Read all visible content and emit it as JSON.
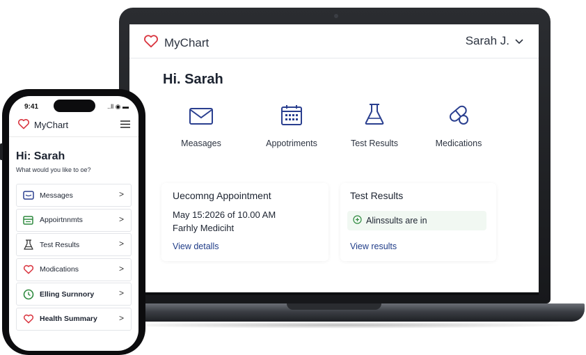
{
  "laptop": {
    "app_name": "MyChart",
    "user_menu": "Sarah J.",
    "greeting": "Hi. Sarah",
    "tiles": [
      {
        "label": "Measages",
        "icon": "envelope-icon"
      },
      {
        "label": "Appotriments",
        "icon": "calendar-icon"
      },
      {
        "label": "Test Results",
        "icon": "flask-icon"
      },
      {
        "label": "Medications",
        "icon": "pills-icon"
      }
    ],
    "appointment_card": {
      "title": "Uecomng Appointment",
      "date": "May 15:2026 of 10.00 AM",
      "department": "Farhly Mediciht",
      "link": "View detalls"
    },
    "results_card": {
      "title": "Test Results",
      "status": "Alinssults are in",
      "link": "View results"
    }
  },
  "phone": {
    "time": "9:41",
    "status_icons": "..ll ◉ ▬",
    "app_name": "MyChart",
    "greeting": "Hi: Sarah",
    "subtitle": "What would you like to oe?",
    "items": [
      {
        "label": "Messages",
        "icon": "envelope-icon"
      },
      {
        "label": "Appoirtnnmts",
        "icon": "card-icon"
      },
      {
        "label": "Test Results",
        "icon": "flask-icon"
      },
      {
        "label": "Modications",
        "icon": "heart-icon"
      },
      {
        "label": "Elling Surnnory",
        "icon": "clock-icon"
      },
      {
        "label": "Health Summary",
        "icon": "heart-icon"
      }
    ],
    "chevron": ">"
  },
  "colors": {
    "brand_red": "#d9353f",
    "navy": "#2a3f8f",
    "link_blue": "#1f3c88",
    "success_green": "#2f8a3f"
  }
}
